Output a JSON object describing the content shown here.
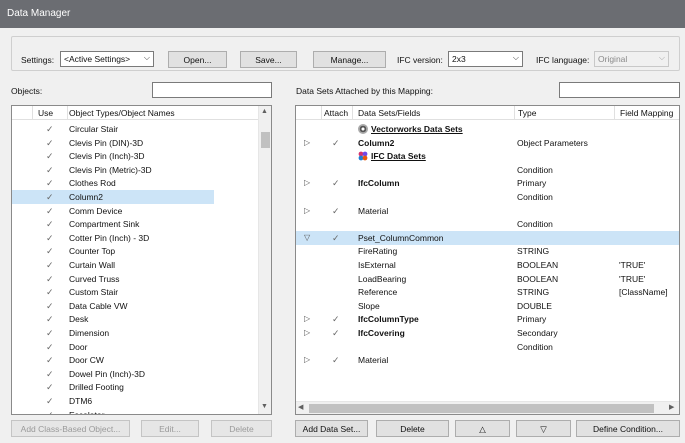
{
  "window": {
    "title": "Data Manager"
  },
  "settings": {
    "label": "Settings:",
    "value": "<Active Settings>",
    "open_button": "Open...",
    "save_button": "Save...",
    "manage_button": "Manage...",
    "ifc_version_label": "IFC version:",
    "ifc_version_value": "2x3",
    "ifc_language_label": "IFC language:",
    "ifc_language_value": "Original"
  },
  "objects": {
    "label": "Objects:",
    "search_value": "",
    "columns": [
      "Use",
      "Object Types/Object Names"
    ],
    "items": [
      {
        "name": "Circular Stair"
      },
      {
        "name": "Clevis Pin (DIN)-3D"
      },
      {
        "name": "Clevis Pin (Inch)-3D"
      },
      {
        "name": "Clevis Pin (Metric)-3D"
      },
      {
        "name": "Clothes Rod"
      },
      {
        "name": "Column2",
        "selected": true
      },
      {
        "name": "Comm Device"
      },
      {
        "name": "Compartment Sink"
      },
      {
        "name": "Cotter Pin (Inch) - 3D"
      },
      {
        "name": "Counter Top"
      },
      {
        "name": "Curtain Wall"
      },
      {
        "name": "Curved Truss"
      },
      {
        "name": "Custom Stair"
      },
      {
        "name": "Data Cable VW"
      },
      {
        "name": "Desk"
      },
      {
        "name": "Dimension"
      },
      {
        "name": "Door"
      },
      {
        "name": "Door CW"
      },
      {
        "name": "Dowel Pin (Inch)-3D"
      },
      {
        "name": "Drilled Footing"
      },
      {
        "name": "DTM6"
      },
      {
        "name": "Escalator"
      }
    ],
    "add_class_button": "Add Class-Based Object...",
    "edit_button": "Edit...",
    "delete_button": "Delete"
  },
  "datasets": {
    "label": "Data Sets Attached by this Mapping:",
    "search_value": "",
    "columns": [
      "Attach",
      "Data Sets/Fields",
      "Type",
      "Field Mapping"
    ],
    "rows": [
      {
        "tri": "",
        "check": false,
        "indent": 0,
        "icon": "wheel",
        "text": "Vectorworks Data Sets",
        "bold": true,
        "underline": true,
        "type": "",
        "mapping": ""
      },
      {
        "tri": "▷",
        "check": true,
        "indent": 0,
        "icon": "",
        "text": "Column2",
        "bold": true,
        "underline": false,
        "type": "Object Parameters",
        "mapping": ""
      },
      {
        "tri": "",
        "check": false,
        "indent": 0,
        "icon": "ifc",
        "text": "IFC Data Sets",
        "bold": true,
        "underline": true,
        "type": "",
        "mapping": ""
      },
      {
        "tri": "",
        "check": false,
        "indent": 0,
        "icon": "",
        "text": "",
        "bold": false,
        "underline": false,
        "type": "Condition",
        "mapping": ""
      },
      {
        "tri": "▷",
        "check": true,
        "indent": 0,
        "icon": "",
        "text": "IfcColumn",
        "bold": true,
        "underline": false,
        "type": "Primary",
        "mapping": ""
      },
      {
        "tri": "",
        "check": false,
        "indent": 0,
        "icon": "",
        "text": "",
        "bold": false,
        "underline": false,
        "type": "Condition",
        "mapping": ""
      },
      {
        "tri": "▷",
        "check": true,
        "indent": 0,
        "icon": "",
        "text": "Material",
        "bold": false,
        "underline": false,
        "type": "",
        "mapping": ""
      },
      {
        "tri": "",
        "check": false,
        "indent": 0,
        "icon": "",
        "text": "",
        "bold": false,
        "underline": false,
        "type": "Condition",
        "mapping": ""
      },
      {
        "tri": "▽",
        "check": true,
        "indent": 0,
        "icon": "",
        "text": "Pset_ColumnCommon",
        "bold": false,
        "underline": false,
        "type": "",
        "mapping": "",
        "selected": true
      },
      {
        "tri": "",
        "check": false,
        "indent": 0,
        "icon": "",
        "text": "FireRating",
        "bold": false,
        "underline": false,
        "type": "STRING",
        "mapping": ""
      },
      {
        "tri": "",
        "check": false,
        "indent": 0,
        "icon": "",
        "text": "IsExternal",
        "bold": false,
        "underline": false,
        "type": "BOOLEAN",
        "mapping": "'TRUE'"
      },
      {
        "tri": "",
        "check": false,
        "indent": 0,
        "icon": "",
        "text": "LoadBearing",
        "bold": false,
        "underline": false,
        "type": "BOOLEAN",
        "mapping": "'TRUE'"
      },
      {
        "tri": "",
        "check": false,
        "indent": 0,
        "icon": "",
        "text": "Reference",
        "bold": false,
        "underline": false,
        "type": "STRING",
        "mapping": "[ClassName]"
      },
      {
        "tri": "",
        "check": false,
        "indent": 0,
        "icon": "",
        "text": "Slope",
        "bold": false,
        "underline": false,
        "type": "DOUBLE",
        "mapping": ""
      },
      {
        "tri": "▷",
        "check": true,
        "indent": 0,
        "icon": "",
        "text": "IfcColumnType",
        "bold": true,
        "underline": false,
        "type": "Primary",
        "mapping": ""
      },
      {
        "tri": "▷",
        "check": true,
        "indent": 0,
        "icon": "",
        "text": "IfcCovering",
        "bold": true,
        "underline": false,
        "type": "Secondary",
        "mapping": ""
      },
      {
        "tri": "",
        "check": false,
        "indent": 0,
        "icon": "",
        "text": "",
        "bold": false,
        "underline": false,
        "type": "Condition",
        "mapping": ""
      },
      {
        "tri": "▷",
        "check": true,
        "indent": 0,
        "icon": "",
        "text": "Material",
        "bold": false,
        "underline": false,
        "type": "",
        "mapping": ""
      }
    ],
    "add_button": "Add Data Set...",
    "delete_button": "Delete",
    "up_button": "△",
    "down_button": "▽",
    "define_condition_button": "Define Condition..."
  },
  "glyphs": {
    "check": "✓",
    "combo_arrow": "⌵",
    "scroll_up": "▲",
    "scroll_down": "▼",
    "scroll_left": "◀",
    "scroll_right": "▶"
  },
  "colors": {
    "selection": "#cce4f7",
    "titlebar": "#6b6d72"
  }
}
